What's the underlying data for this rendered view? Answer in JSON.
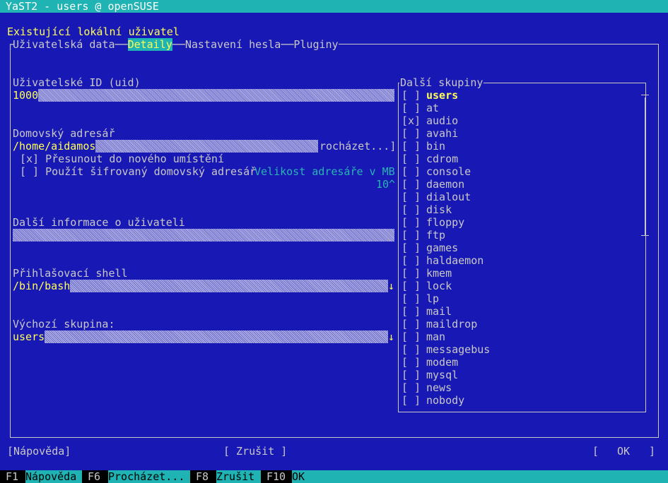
{
  "window": {
    "title": "YaST2 - users @ openSUSE"
  },
  "dialog": {
    "heading": "Existující lokální uživatel"
  },
  "tabs": [
    {
      "label": "Uživatelská data",
      "active": false
    },
    {
      "label": "Detaily",
      "active": true
    },
    {
      "label": "Nastavení hesla",
      "active": false
    },
    {
      "label": "Pluginy",
      "active": false
    }
  ],
  "uid": {
    "label": "Uživatelské ID (uid)",
    "value": "1000"
  },
  "home": {
    "label": "Domovský adresář",
    "value": "/home/aidamos",
    "browse_label": "rocházet...]",
    "move_checkbox": {
      "mark": "[x]",
      "label": "Přesunout do nového umístění"
    },
    "encrypt_checkbox": {
      "mark": "[ ]",
      "label": "Použít šifrovaný domovský adresář"
    },
    "size_label": "Velikost adresáře v MB",
    "size_value": "10^"
  },
  "extra_info": {
    "label": "Další informace o uživateli",
    "value": ""
  },
  "shell": {
    "label": "Přihlašovací shell",
    "value": "/bin/bash",
    "arrow": "↓"
  },
  "default_group": {
    "label": "Výchozí skupina:",
    "value": "users",
    "arrow": "↓"
  },
  "groups": {
    "title": "Další skupiny",
    "items": [
      {
        "mark": "[ ]",
        "name": "users"
      },
      {
        "mark": "[ ]",
        "name": "at"
      },
      {
        "mark": "[x]",
        "name": "audio"
      },
      {
        "mark": "[ ]",
        "name": "avahi"
      },
      {
        "mark": "[ ]",
        "name": "bin"
      },
      {
        "mark": "[ ]",
        "name": "cdrom"
      },
      {
        "mark": "[ ]",
        "name": "console"
      },
      {
        "mark": "[ ]",
        "name": "daemon"
      },
      {
        "mark": "[ ]",
        "name": "dialout"
      },
      {
        "mark": "[ ]",
        "name": "disk"
      },
      {
        "mark": "[ ]",
        "name": "floppy"
      },
      {
        "mark": "[ ]",
        "name": "ftp"
      },
      {
        "mark": "[ ]",
        "name": "games"
      },
      {
        "mark": "[ ]",
        "name": "haldaemon"
      },
      {
        "mark": "[ ]",
        "name": "kmem"
      },
      {
        "mark": "[ ]",
        "name": "lock"
      },
      {
        "mark": "[ ]",
        "name": "lp"
      },
      {
        "mark": "[ ]",
        "name": "mail"
      },
      {
        "mark": "[ ]",
        "name": "maildrop"
      },
      {
        "mark": "[ ]",
        "name": "man"
      },
      {
        "mark": "[ ]",
        "name": "messagebus"
      },
      {
        "mark": "[ ]",
        "name": "modem"
      },
      {
        "mark": "[ ]",
        "name": "mysql"
      },
      {
        "mark": "[ ]",
        "name": "news"
      },
      {
        "mark": "[ ]",
        "name": "nobody"
      }
    ]
  },
  "buttons": {
    "help": "[Nápověda]",
    "cancel": "[ Zrušit ]",
    "ok_open": "[",
    "ok": "OK",
    "ok_close": "]"
  },
  "fkeys": [
    {
      "key": "F1",
      "label": "Nápověda"
    },
    {
      "key": "F6",
      "label": "Procházet..."
    },
    {
      "key": "F8",
      "label": "Zrušit"
    },
    {
      "key": "F10",
      "label": "OK"
    }
  ],
  "colors": {
    "background": "#1818b4",
    "accent": "#1fb3b3",
    "highlight": "#ffff55",
    "text": "#c8c8c8"
  }
}
